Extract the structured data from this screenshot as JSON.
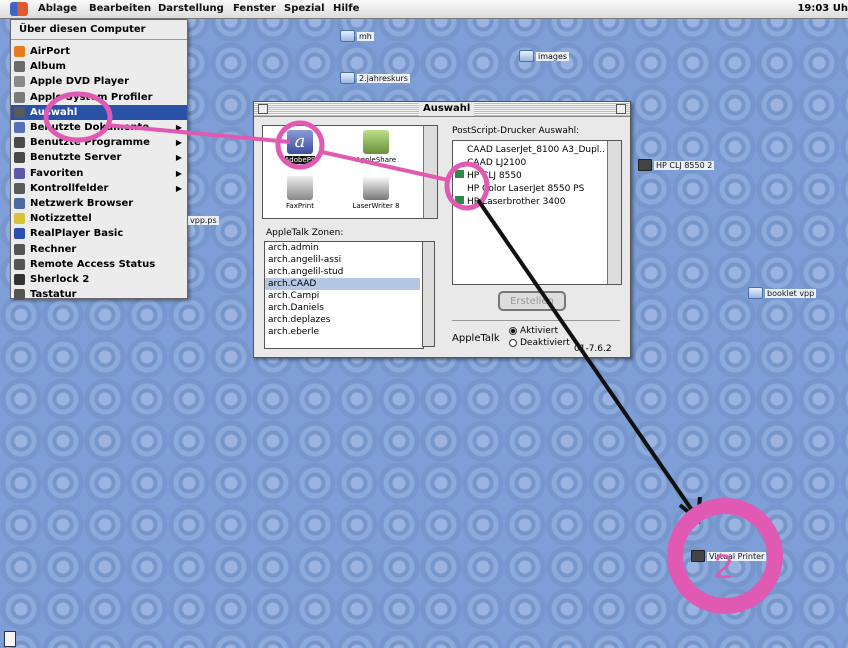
{
  "menubar": {
    "items": [
      "Ablage",
      "Bearbeiten",
      "Darstellung",
      "Fenster",
      "Spezial",
      "Hilfe"
    ],
    "clock": "19:03 Uh"
  },
  "apple_menu": {
    "header": "Über diesen Computer",
    "items": [
      {
        "label": "AirPort",
        "icon": "airport-icon",
        "color": "#e87a20"
      },
      {
        "label": "Album",
        "icon": "album-icon",
        "color": "#6b6b6b"
      },
      {
        "label": "Apple DVD Player",
        "icon": "dvd-icon",
        "color": "#8a8a8a"
      },
      {
        "label": "Apple System Profiler",
        "icon": "profiler-icon",
        "color": "#7a7a7a"
      },
      {
        "label": "Auswahl",
        "icon": "chooser-icon",
        "color": "#5a5a5a",
        "selected": true
      },
      {
        "label": "Benutzte Dokumente",
        "icon": "documents-icon",
        "color": "#5570b5",
        "submenu": true
      },
      {
        "label": "Benutzte Programme",
        "icon": "programs-icon",
        "color": "#4a4a4a",
        "submenu": true
      },
      {
        "label": "Benutzte Server",
        "icon": "server-icon",
        "color": "#4a4a4a",
        "submenu": true
      },
      {
        "label": "Favoriten",
        "icon": "favorites-icon",
        "color": "#5a5aa8",
        "submenu": true
      },
      {
        "label": "Kontrollfelder",
        "icon": "controlpanels-icon",
        "color": "#5a5a5a",
        "submenu": true
      },
      {
        "label": "Netzwerk Browser",
        "icon": "network-icon",
        "color": "#4a6aa0"
      },
      {
        "label": "Notizzettel",
        "icon": "notes-icon",
        "color": "#d9c13a"
      },
      {
        "label": "RealPlayer Basic",
        "icon": "realplayer-icon",
        "color": "#2a4fb0"
      },
      {
        "label": "Rechner",
        "icon": "calculator-icon",
        "color": "#555555"
      },
      {
        "label": "Remote Access Status",
        "icon": "remote-icon",
        "color": "#555555"
      },
      {
        "label": "Sherlock 2",
        "icon": "sherlock-icon",
        "color": "#333333"
      },
      {
        "label": "Tastatur",
        "icon": "keyboard-icon",
        "color": "#555555"
      }
    ]
  },
  "desktop": {
    "icons": [
      {
        "label": "mh",
        "kind": "folder"
      },
      {
        "label": "images",
        "kind": "folder"
      },
      {
        "label": "2.jahreskurs",
        "kind": "folder"
      },
      {
        "label": "HP CLJ 8550 2",
        "kind": "printer"
      },
      {
        "label": "vpp.ps",
        "kind": "file"
      },
      {
        "label": "booklet vpp",
        "kind": "folder"
      },
      {
        "label": "Virtual Printer",
        "kind": "printer"
      }
    ]
  },
  "chooser": {
    "title": "Auswahl",
    "drivers": [
      {
        "label": "AdobePS",
        "selected": true,
        "color": "#3b4fa0"
      },
      {
        "label": "AppleShare",
        "selected": false,
        "color": "#6b8f3a"
      },
      {
        "label": "FaxPrint",
        "selected": false,
        "color": "#666666"
      },
      {
        "label": "LaserWriter 8",
        "selected": false,
        "color": "#555555"
      }
    ],
    "zones_label": "AppleTalk Zonen:",
    "zones": [
      {
        "name": "arch.admin"
      },
      {
        "name": "arch.angelil-assi"
      },
      {
        "name": "arch.angelil-stud"
      },
      {
        "name": "arch.CAAD",
        "selected": true
      },
      {
        "name": "arch.Campi"
      },
      {
        "name": "arch.Daniels"
      },
      {
        "name": "arch.deplazes"
      },
      {
        "name": "arch.eberle"
      }
    ],
    "printers_label": "PostScript-Drucker Auswahl:",
    "printers": [
      {
        "name": "CAAD LaserJet_8100 A3_Dupl...",
        "selected": false
      },
      {
        "name": "CAAD LJ2100",
        "selected": false
      },
      {
        "name": "HP CLJ 8550",
        "selected": true
      },
      {
        "name": "HP Color LaserJet 8550 PS",
        "selected": false
      },
      {
        "name": "HP Laserbrother 3400",
        "selected": true
      }
    ],
    "create_button": "Erstellen",
    "appletalk_label": "AppleTalk",
    "radio_on": "Aktiviert",
    "radio_off": "Deaktiviert",
    "version": "01-7.6.2"
  },
  "annotations": {
    "step_number": "2",
    "circle_color": "#e05ab4",
    "arrow_color": "#111111"
  }
}
